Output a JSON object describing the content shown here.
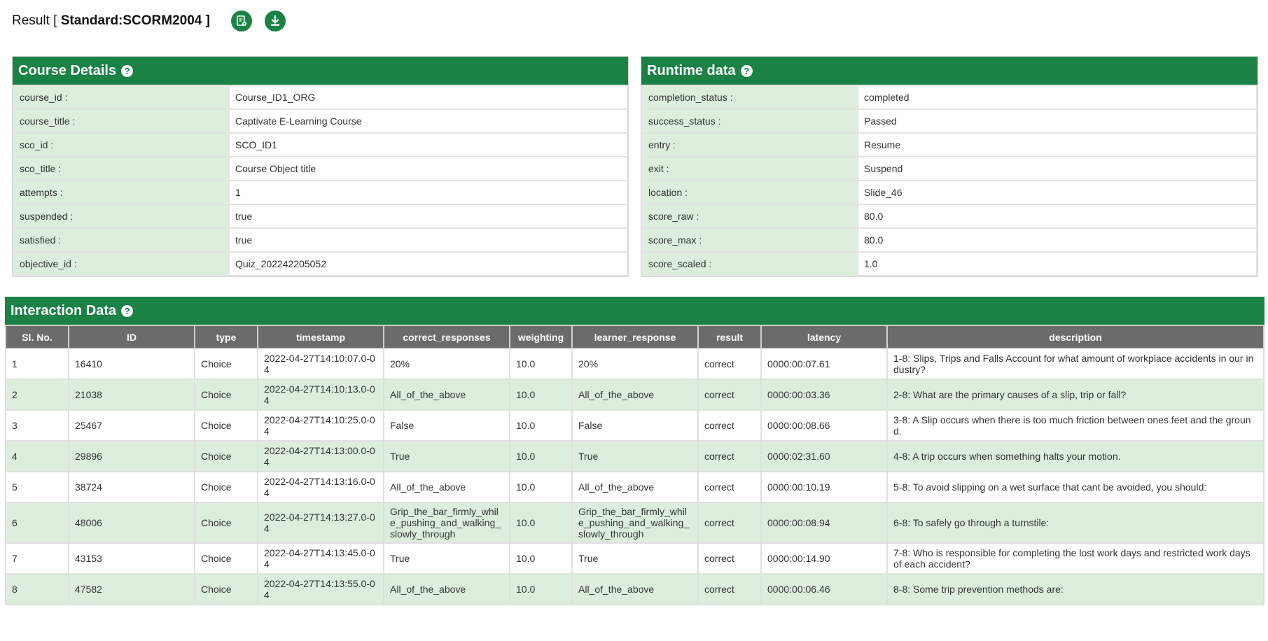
{
  "header": {
    "title_prefix": "Result [ ",
    "title_standard": "Standard:SCORM2004",
    "title_suffix": " ]",
    "report_icon": "report-icon",
    "download_icon": "download-icon"
  },
  "colors": {
    "accent": "#1a8245",
    "table_header": "#6b6b6b",
    "row_alt": "#ddeedd"
  },
  "course_details": {
    "title": "Course Details",
    "rows": [
      {
        "key": "course_id :",
        "value": "Course_ID1_ORG"
      },
      {
        "key": "course_title :",
        "value": "Captivate E-Learning Course"
      },
      {
        "key": "sco_id :",
        "value": "SCO_ID1"
      },
      {
        "key": "sco_title :",
        "value": "Course Object title"
      },
      {
        "key": "attempts :",
        "value": "1"
      },
      {
        "key": "suspended :",
        "value": "true"
      },
      {
        "key": "satisfied :",
        "value": "true"
      },
      {
        "key": "objective_id :",
        "value": "Quiz_202242205052"
      }
    ]
  },
  "runtime_data": {
    "title": "Runtime data",
    "rows": [
      {
        "key": "completion_status :",
        "value": "completed"
      },
      {
        "key": "success_status :",
        "value": "Passed"
      },
      {
        "key": "entry :",
        "value": "Resume"
      },
      {
        "key": "exit :",
        "value": "Suspend"
      },
      {
        "key": "location :",
        "value": "Slide_46"
      },
      {
        "key": "score_raw :",
        "value": "80.0"
      },
      {
        "key": "score_max :",
        "value": "80.0"
      },
      {
        "key": "score_scaled :",
        "value": "1.0"
      }
    ]
  },
  "interaction_data": {
    "title": "Interaction Data",
    "columns": [
      "Sl. No.",
      "ID",
      "type",
      "timestamp",
      "correct_responses",
      "weighting",
      "learner_response",
      "result",
      "latency",
      "description"
    ],
    "rows": [
      [
        "1",
        "16410",
        "Choice",
        "2022-04-27T14:10:07.0-04",
        "20%",
        "10.0",
        "20%",
        "correct",
        "0000:00:07.61",
        "1-8: Slips, Trips and Falls Account for what amount of workplace accidents in our industry?"
      ],
      [
        "2",
        "21038",
        "Choice",
        "2022-04-27T14:10:13.0-04",
        "All_of_the_above",
        "10.0",
        "All_of_the_above",
        "correct",
        "0000:00:03.36",
        "2-8: What are the primary causes of a slip, trip or fall?"
      ],
      [
        "3",
        "25467",
        "Choice",
        "2022-04-27T14:10:25.0-04",
        "False",
        "10.0",
        "False",
        "correct",
        "0000:00:08.66",
        "3-8: A Slip occurs when there is too much friction between ones feet and the ground."
      ],
      [
        "4",
        "29896",
        "Choice",
        "2022-04-27T14:13:00.0-04",
        "True",
        "10.0",
        "True",
        "correct",
        "0000:02:31.60",
        "4-8: A trip occurs when something halts your motion."
      ],
      [
        "5",
        "38724",
        "Choice",
        "2022-04-27T14:13:16.0-04",
        "All_of_the_above",
        "10.0",
        "All_of_the_above",
        "correct",
        "0000:00:10.19",
        "5-8: To avoid slipping on a wet surface that cant be avoided, you should:"
      ],
      [
        "6",
        "48006",
        "Choice",
        "2022-04-27T14:13:27.0-04",
        "Grip_the_bar_firmly_while_pushing_and_walking_slowly_through",
        "10.0",
        "Grip_the_bar_firmly_while_pushing_and_walking_slowly_through",
        "correct",
        "0000:00:08.94",
        "6-8: To safely go through a turnstile:"
      ],
      [
        "7",
        "43153",
        "Choice",
        "2022-04-27T14:13:45.0-04",
        "True",
        "10.0",
        "True",
        "correct",
        "0000:00:14.90",
        "7-8: Who is responsible for completing the lost work days and restricted work days of each accident?"
      ],
      [
        "8",
        "47582",
        "Choice",
        "2022-04-27T14:13:55.0-04",
        "All_of_the_above",
        "10.0",
        "All_of_the_above",
        "correct",
        "0000:00:06.46",
        "8-8: Some trip prevention methods are:"
      ]
    ]
  }
}
